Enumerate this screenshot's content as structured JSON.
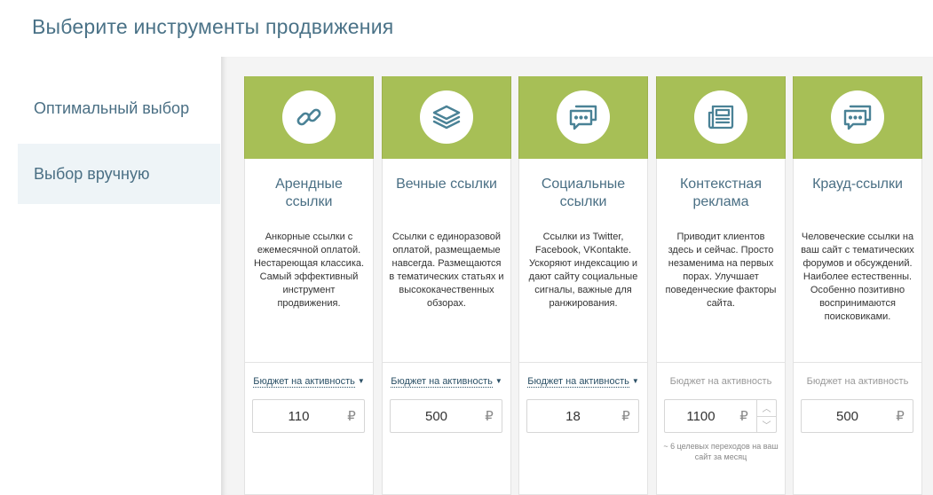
{
  "page": {
    "title": "Выберите инструменты продвижения"
  },
  "menu": {
    "items": [
      {
        "label": "Оптимальный выбор",
        "active": false
      },
      {
        "label": "Выбор вручную",
        "active": true
      }
    ]
  },
  "colors": {
    "card_header": "#a7bf56",
    "icon": "#4a8296",
    "title_text": "#4a6f84"
  },
  "currency": "₽",
  "cards": [
    {
      "icon": "link-icon",
      "title": "Арендные ссылки",
      "description": "Анкорные ссылки с ежемесячной оплатой. Нестареющая классика. Самый эффективный инструмент продвижения.",
      "budget_label": "Бюджет на активность",
      "budget_value": "110"
    },
    {
      "icon": "layers-icon",
      "title": "Вечные ссылки",
      "description": "Ссылки с единоразовой оплатой, размещаемые навсегда. Размещаются в тематических статьях и высококачественных обзорах.",
      "budget_label": "Бюджет на активность",
      "budget_value": "500"
    },
    {
      "icon": "chat-icon",
      "title": "Социальные ссылки",
      "description": "Ссылки из Twitter, Facebook, VKontakte. Ускоряют индексацию и дают сайту социальные сигналы, важные для ранжирования.",
      "budget_label": "Бюджет на активность",
      "budget_value": "18"
    },
    {
      "icon": "newspaper-icon",
      "title": "Контекстная реклама",
      "description": "Приводит клиентов здесь и сейчас. Просто незаменима на первых порах. Улучшает поведенческие факторы сайта.",
      "budget_label": "Бюджет на активность",
      "budget_value": "1100",
      "budget_note": "~ 6 целевых переходов на ваш сайт за месяц"
    },
    {
      "icon": "chat-icon",
      "title": "Крауд-ссылки",
      "description": "Человеческие ссылки на ваш сайт с тематических форумов и обсуждений. Наиболее естественны. Особенно позитивно воспринимаются поисковиками.",
      "budget_label": "Бюджет на активность",
      "budget_value": "500"
    }
  ]
}
